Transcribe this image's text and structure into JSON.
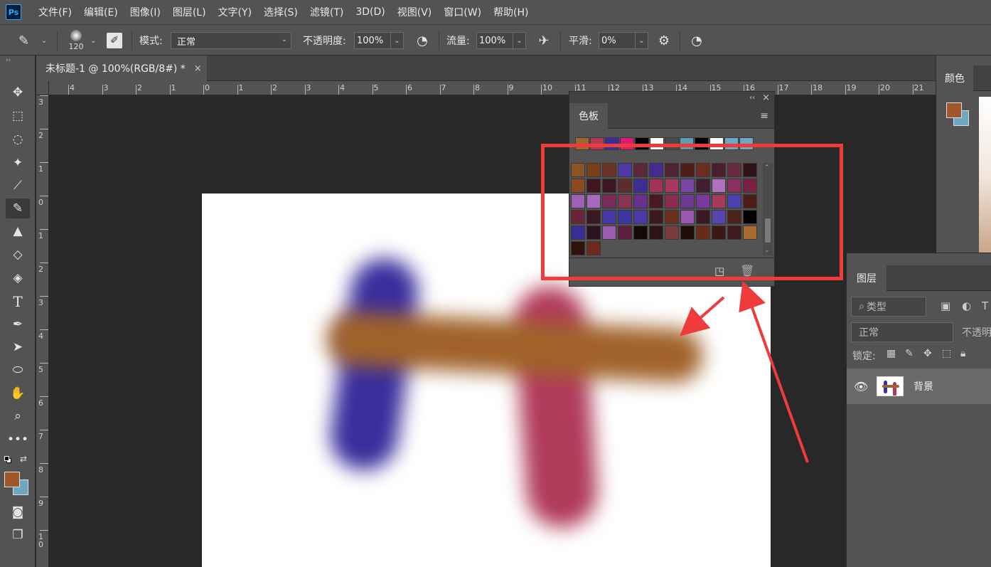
{
  "menu": {
    "logo": "Ps",
    "items": [
      "文件(F)",
      "编辑(E)",
      "图像(I)",
      "图层(L)",
      "文字(Y)",
      "选择(S)",
      "滤镜(T)",
      "3D(D)",
      "视图(V)",
      "窗口(W)",
      "帮助(H)"
    ]
  },
  "options": {
    "brush_size": "120",
    "mode_label": "模式:",
    "mode_value": "正常",
    "opacity_label": "不透明度:",
    "opacity_value": "100%",
    "flow_label": "流量:",
    "flow_value": "100%",
    "smooth_label": "平滑:",
    "smooth_value": "0%"
  },
  "document": {
    "tab_title": "未标题-1 @ 100%(RGB/8#) *",
    "close": "×"
  },
  "ruler": {
    "top_labels": [
      "4",
      "3",
      "2",
      "1",
      "0",
      "1",
      "2",
      "3",
      "4",
      "5",
      "6",
      "7",
      "8",
      "9",
      "10",
      "11",
      "12",
      "13",
      "14",
      "15",
      "16",
      "17",
      "18",
      "19",
      "20",
      "21"
    ],
    "left_labels": [
      "3",
      "2",
      "1",
      "0",
      "1",
      "2",
      "3",
      "4",
      "5",
      "6",
      "7",
      "8",
      "9",
      "1\n0"
    ]
  },
  "swatches": {
    "title": "色板",
    "collapse": "‹‹",
    "close": "×",
    "recent_colors": [
      "#a0662a",
      "#b43a5a",
      "#3c2e9a",
      "#e01a74",
      "#000000",
      "#ffffff",
      "#4a4a4a",
      "#5e9ab0",
      "#000000",
      "#ffffff",
      "#6fa7c0",
      "#6fa7c0"
    ],
    "grid_colors": [
      "#8a5423",
      "#7a3f17",
      "#6b3228",
      "#4d39a6",
      "#5c2a36",
      "#432b8f",
      "#4e2430",
      "#4f1d17",
      "#6a2d20",
      "#4a1e2c",
      "#6b2a44",
      "#2e1414",
      "#8d4a22",
      "#3e1620",
      "#3a1722",
      "#5e2c2c",
      "#3f2d92",
      "#a03258",
      "#a83860",
      "#7a46a4",
      "#402030",
      "#b070c0",
      "#8a3060",
      "#7a2040",
      "#a060b8",
      "#a868c0",
      "#7a2c58",
      "#8a3454",
      "#6a3090",
      "#4a1a22",
      "#8a2c4c",
      "#6c3a94",
      "#7a3a9c",
      "#a63a5a",
      "#4a40b0",
      "#4a1e16",
      "#6a2438",
      "#3a1820",
      "#4838a8",
      "#3f35a0",
      "#4a3aa8",
      "#3a1a1a",
      "#6a2e1e",
      "#9a58b4",
      "#3a1a22",
      "#5844b0",
      "#4a2418",
      "#000000",
      "#3a2e96",
      "#2a1220",
      "#9a5cae",
      "#5e1e3e",
      "#140808",
      "#2c1410",
      "#7a3c3c",
      "#200c0a",
      "#6a2a18",
      "#3a1818",
      "#3e1a1a",
      "#a86a2e",
      "#2e120e",
      "#6a2a1e"
    ]
  },
  "right": {
    "color_tab": "颜色"
  },
  "layers": {
    "title": "图层",
    "filter_placeholder": "类型",
    "blend_mode": "正常",
    "opacity_label": "不透明",
    "lock_label": "锁定:",
    "layer_name": "背景"
  },
  "colors": {
    "foreground": "#a0582a",
    "background": "#6fa7c0",
    "annotation": "#ef3b3b"
  }
}
